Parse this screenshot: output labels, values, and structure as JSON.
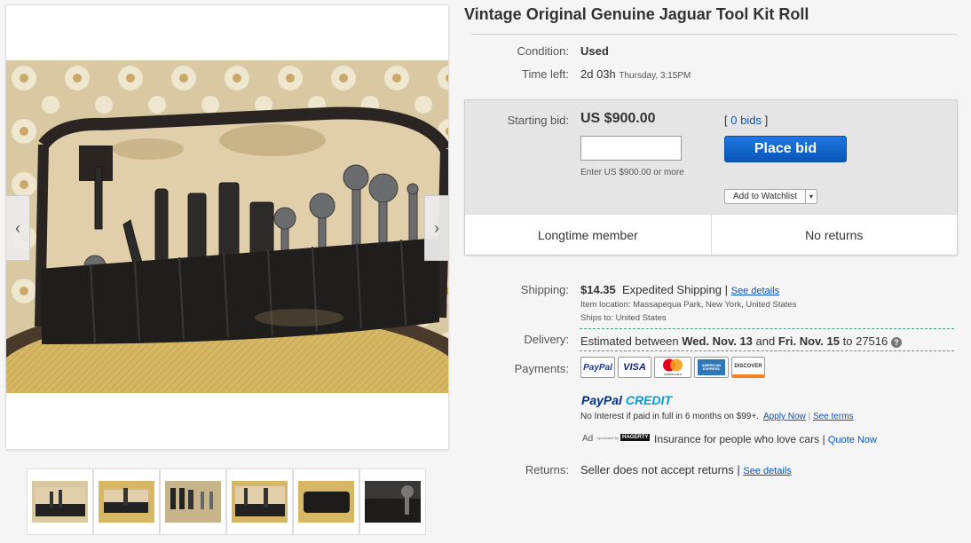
{
  "listing": {
    "title": "Vintage Original Genuine Jaguar Tool Kit Roll"
  },
  "condition": {
    "label": "Condition:",
    "value": "Used"
  },
  "time_left": {
    "label": "Time left:",
    "value": "2d 03h",
    "detail": "Thursday, 3:15PM"
  },
  "bid": {
    "label": "Starting bid:",
    "price": "US $900.00",
    "bids_link": "0 bids",
    "bids_open": "[",
    "bids_close": "]",
    "input_value": "",
    "hint": "Enter US $900.00 or more",
    "place_bid": "Place bid",
    "watchlist": "Add to Watchlist",
    "watchlist_arrow": "▾"
  },
  "badges": [
    "Longtime member",
    "No returns"
  ],
  "shipping": {
    "label": "Shipping:",
    "price": "$14.35",
    "method": "Expedited Shipping",
    "sep": "|",
    "details_link": "See details",
    "location": "Item location:  Massapequa Park, New York, United States",
    "ships_to": "Ships to:  United States"
  },
  "delivery": {
    "label": "Delivery:",
    "prefix": "Estimated between",
    "from": "Wed. Nov. 13",
    "and": "and",
    "to": "Fri. Nov. 15",
    "zip_prefix": "to",
    "zip": "27516",
    "help": "?"
  },
  "payments": {
    "label": "Payments:",
    "methods": [
      "PayPal",
      "VISA",
      "mastercard",
      "AMERICAN EXPRESS",
      "DISCOVER"
    ],
    "credit_brand_a": "PayPal",
    "credit_brand_b": "CREDIT",
    "credit_text": "No Interest if paid in full in 6 months on $99+.",
    "apply_link": "Apply Now",
    "sep": "|",
    "terms_link": "See terms"
  },
  "ad": {
    "label": "Ad",
    "sponsor": "sponsored by",
    "brand": "HAGERTY",
    "text": "Insurance for people who love cars",
    "sep": "|",
    "link": "Quote Now"
  },
  "returns": {
    "label": "Returns:",
    "value": "Seller does not accept returns",
    "sep": "|",
    "link": "See details"
  },
  "gallery": {
    "prev": "‹",
    "next": "›",
    "thumb_count": 6
  },
  "colors": {
    "link": "#0654ba",
    "place_bid": "#0b5fcd",
    "bid_panel": "#e5e5e5",
    "accent_dashed": "#4a9a8a"
  }
}
